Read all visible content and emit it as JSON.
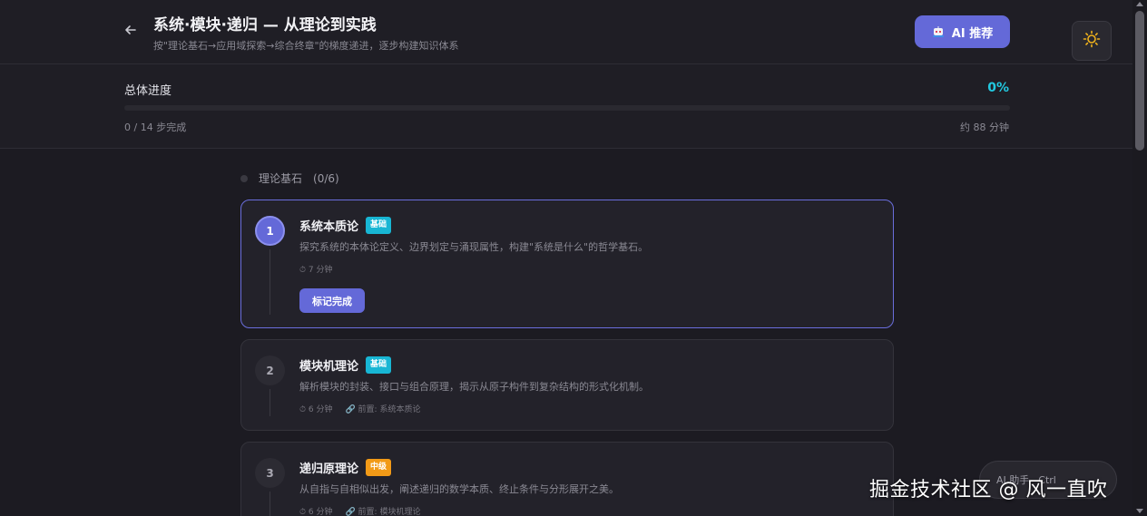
{
  "header": {
    "title": "系统·模块·递归 — 从理论到实践",
    "subtitle": "按\"理论基石→应用域探索→综合终章\"的梯度递进，逐步构建知识体系",
    "ai_button_label": "AI 推荐"
  },
  "progress": {
    "label": "总体进度",
    "percent_text": "0%",
    "fraction": 0,
    "steps_text": "0 / 14 步完成",
    "time_text": "约 88 分钟",
    "accent_color": "#22c9e0"
  },
  "section": {
    "title": "理论基石",
    "count": "(0/6)"
  },
  "cards": [
    {
      "num": "1",
      "title": "系统本质论",
      "badge": "基础",
      "desc": "探究系统的本体论定义、边界划定与涌现属性，构建\"系统是什么\"的哲学基石。",
      "duration": "⏱ 7 分钟",
      "prereq": "",
      "button": "标记完成"
    },
    {
      "num": "2",
      "title": "模块机理论",
      "badge": "基础",
      "desc": "解析模块的封装、接口与组合原理，揭示从原子构件到复杂结构的形式化机制。",
      "duration": "⏱ 6 分钟",
      "prereq": "前置: 系统本质论"
    },
    {
      "num": "3",
      "title": "递归原理论",
      "badge": "中级",
      "desc": "从自指与自相似出发，阐述递归的数学本质、终止条件与分形展开之美。",
      "duration": "⏱ 6 分钟",
      "prereq": "前置: 模块机理论"
    }
  ],
  "float_pill": {
    "label": "AI 助手",
    "shortcut": "Ctrl"
  },
  "watermark": "掘金技术社区 @ 风一直吹",
  "colors": {
    "accent": "#6469d8",
    "badge_basic": "#18b6d4",
    "badge_mid": "#f29a17",
    "background": "#1c1b22"
  },
  "icons": {
    "back": "arrow-left-icon",
    "ai": "robot-icon",
    "theme": "sun-icon",
    "duration": "stopwatch-icon",
    "prereq": "link-icon"
  }
}
